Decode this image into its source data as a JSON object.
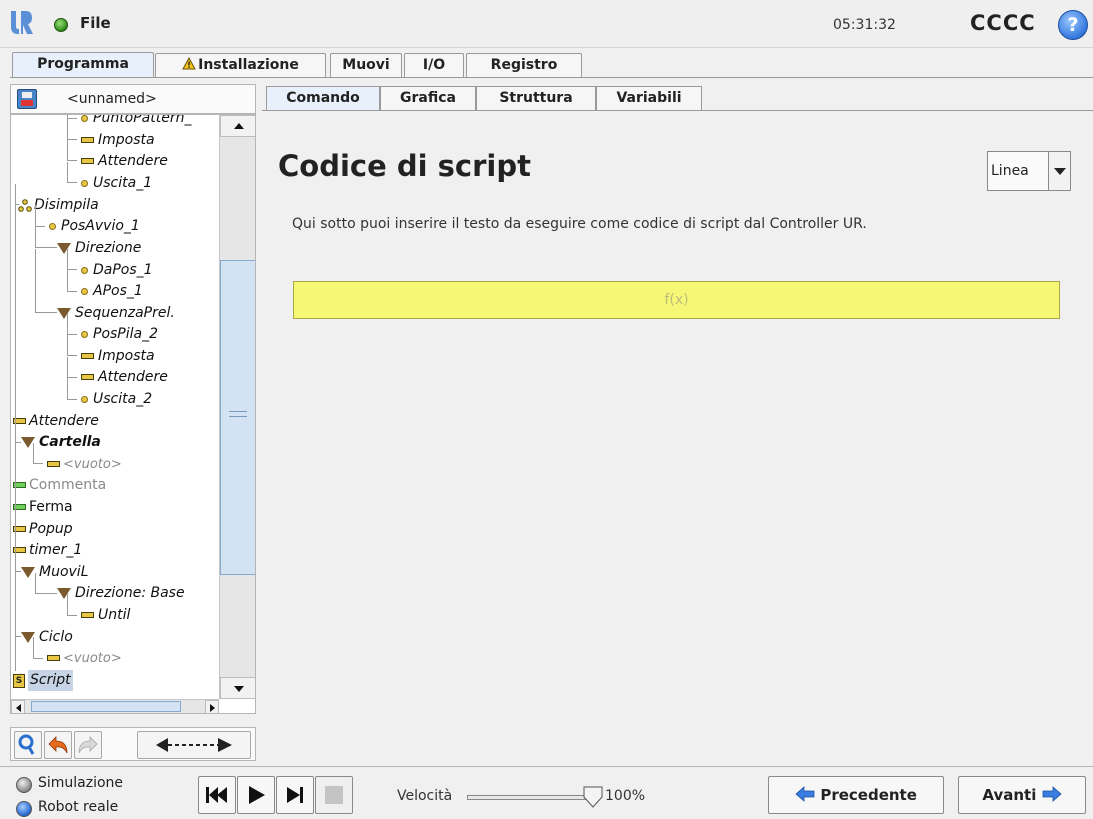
{
  "header": {
    "file_label": "File",
    "clock": "05:31:32",
    "robot_name": "CCCC",
    "help_label": "?"
  },
  "main_tabs": [
    {
      "label": "Programma",
      "active": true
    },
    {
      "label": "Installazione",
      "warning": true
    },
    {
      "label": "Muovi"
    },
    {
      "label": "I/O"
    },
    {
      "label": "Registro"
    }
  ],
  "program": {
    "name": "<unnamed>"
  },
  "tree": [
    {
      "label": "PuntoPattern_",
      "icon": "waypoint-dot-icon"
    },
    {
      "label": "Imposta",
      "icon": "set-bar-icon"
    },
    {
      "label": "Attendere",
      "icon": "wait-bar-icon"
    },
    {
      "label": "Uscita_1",
      "icon": "waypoint-dot-icon"
    },
    {
      "label": "Disimpila",
      "icon": "destack-icon"
    },
    {
      "label": "PosAvvio_1",
      "icon": "waypoint-dot-icon"
    },
    {
      "label": "Direzione",
      "icon": "folder-triangle-icon"
    },
    {
      "label": "DaPos_1",
      "icon": "waypoint-dot-icon"
    },
    {
      "label": "APos_1",
      "icon": "waypoint-dot-icon"
    },
    {
      "label": "SequenzaPrel.",
      "icon": "folder-triangle-icon"
    },
    {
      "label": "PosPila_2",
      "icon": "waypoint-dot-icon"
    },
    {
      "label": "Imposta",
      "icon": "set-bar-icon"
    },
    {
      "label": "Attendere",
      "icon": "wait-bar-icon"
    },
    {
      "label": "Uscita_2",
      "icon": "waypoint-dot-icon"
    },
    {
      "label": "Attendere",
      "icon": "wait-bar-icon"
    },
    {
      "label": "Cartella",
      "icon": "folder-triangle-icon"
    },
    {
      "label": "<vuoto>",
      "icon": "empty-bar-icon"
    },
    {
      "label": "Commenta",
      "icon": "comment-bar-icon"
    },
    {
      "label": "Ferma",
      "icon": "halt-bar-icon"
    },
    {
      "label": "Popup",
      "icon": "popup-bar-icon"
    },
    {
      "label": "timer_1",
      "icon": "timer-bar-icon"
    },
    {
      "label": "MuoviL",
      "icon": "folder-triangle-icon"
    },
    {
      "label": "Direzione: Base",
      "icon": "folder-triangle-icon"
    },
    {
      "label": "Until",
      "icon": "until-bar-icon"
    },
    {
      "label": "Ciclo",
      "icon": "folder-triangle-icon"
    },
    {
      "label": "<vuoto>",
      "icon": "empty-bar-icon"
    },
    {
      "label": "Script",
      "icon": "script-icon",
      "selected": true
    }
  ],
  "sub_tabs": [
    {
      "label": "Comando",
      "active": true
    },
    {
      "label": "Grafica"
    },
    {
      "label": "Struttura"
    },
    {
      "label": "Variabili"
    }
  ],
  "command": {
    "title": "Codice di script",
    "mode_value": "Linea",
    "description": "Qui sotto puoi inserire il testo da eseguire come codice di script dal Controller UR.",
    "script_placeholder": "f(x)"
  },
  "footer": {
    "simulation_label": "Simulazione",
    "real_robot_label": "Robot reale",
    "speed_label": "Velocità",
    "speed_value": "100%",
    "speed_fraction": 1.0,
    "prev_label": "Precedente",
    "next_label": "Avanti"
  },
  "colors": {
    "script_field_bg": "#f7f776",
    "active_tab_bg": "#e8f1fb",
    "accent_blue": "#3a7de0"
  }
}
